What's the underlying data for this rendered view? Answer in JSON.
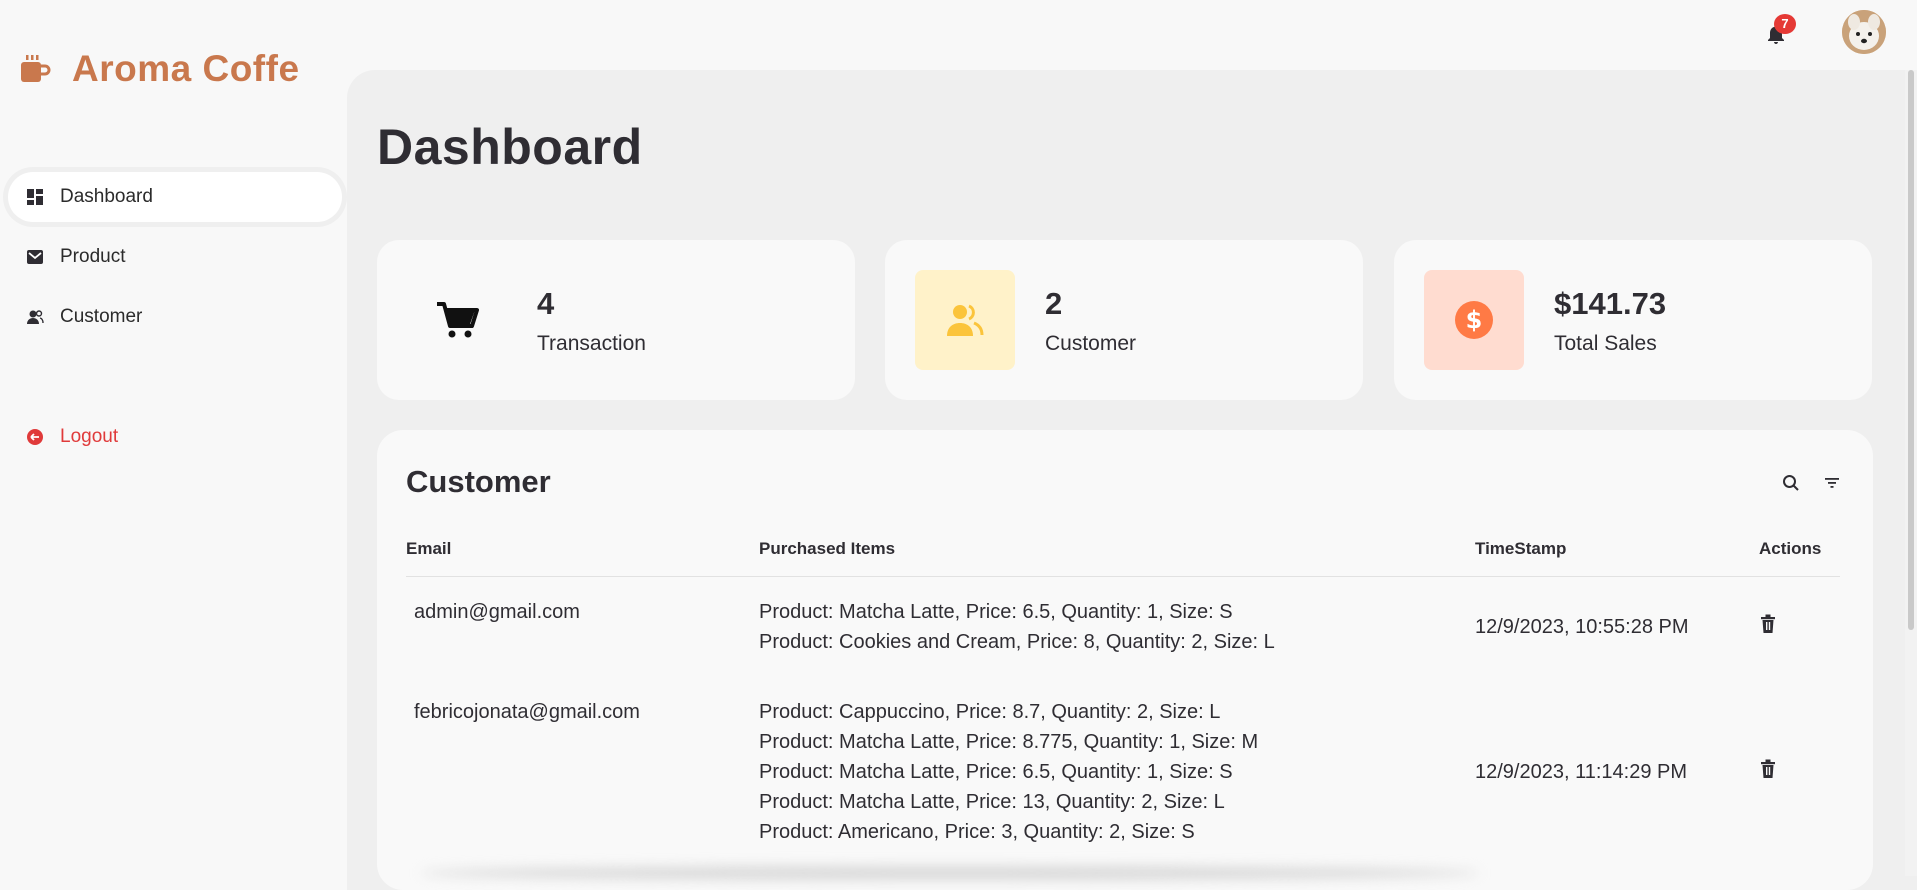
{
  "app": {
    "brand": "Aroma Coffe",
    "accent_color": "#c9784d",
    "logout_color": "#e03a3a"
  },
  "header": {
    "notification_count": "7"
  },
  "sidebar": {
    "items": [
      {
        "label": "Dashboard",
        "icon": "dashboard-icon",
        "active": true
      },
      {
        "label": "Product",
        "icon": "product-icon",
        "active": false
      },
      {
        "label": "Customer",
        "icon": "customer-icon",
        "active": false
      }
    ],
    "logout_label": "Logout"
  },
  "main": {
    "title": "Dashboard",
    "stats": [
      {
        "value": "4",
        "label": "Transaction",
        "icon": "cart-icon"
      },
      {
        "value": "2",
        "label": "Customer",
        "icon": "users-icon",
        "color": "#fbc43b",
        "bg": "#fff2c9"
      },
      {
        "value": "$141.73",
        "label": "Total Sales",
        "icon": "dollar-icon",
        "color": "#ff7a45",
        "bg": "#ffdcd0"
      }
    ],
    "table": {
      "title": "Customer",
      "columns": [
        "Email",
        "Purchased Items",
        "TimeStamp",
        "Actions"
      ],
      "rows": [
        {
          "email": "admin@gmail.com",
          "items": [
            "Product: Matcha Latte, Price: 6.5, Quantity: 1, Size: S",
            "Product: Cookies and Cream, Price: 8, Quantity: 2, Size: L"
          ],
          "timestamp": "12/9/2023, 10:55:28 PM"
        },
        {
          "email": "febricojonata@gmail.com",
          "items": [
            "Product: Cappuccino, Price: 8.7, Quantity: 2, Size: L",
            "Product: Matcha Latte, Price: 8.775, Quantity: 1, Size: M",
            "Product: Matcha Latte, Price: 6.5, Quantity: 1, Size: S",
            "Product: Matcha Latte, Price: 13, Quantity: 2, Size: L",
            "Product: Americano, Price: 3, Quantity: 2, Size: S"
          ],
          "timestamp": "12/9/2023, 11:14:29 PM"
        }
      ]
    }
  }
}
